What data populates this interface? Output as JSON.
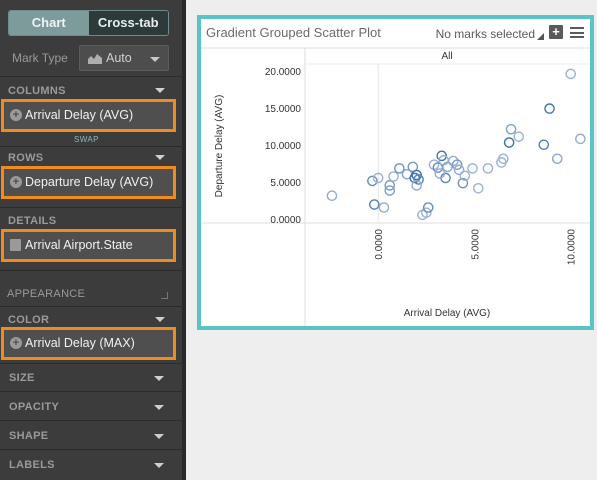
{
  "sidebar": {
    "tabs": [
      {
        "label": "Chart",
        "active": true
      },
      {
        "label": "Cross-tab",
        "active": false
      }
    ],
    "mark_type": {
      "label": "Mark Type",
      "value": "Auto",
      "icon": "area-chart-icon"
    },
    "sections": {
      "columns": {
        "label": "COLUMNS",
        "pill": "Arrival Delay (AVG)",
        "swap": "SWAP"
      },
      "rows": {
        "label": "ROWS",
        "pill": "Departure Delay (AVG)"
      },
      "details": {
        "label": "DETAILS",
        "pill": "Arrival Airport.State"
      },
      "appearance": {
        "label": "APPEARANCE"
      },
      "color": {
        "label": "COLOR",
        "pill": "Arrival Delay (MAX)"
      },
      "size": {
        "label": "SIZE"
      },
      "opacity": {
        "label": "OPACITY"
      },
      "shape": {
        "label": "SHAPE"
      },
      "labels": {
        "label": "LABELS"
      }
    },
    "colors": {
      "highlight": "#f08c1e",
      "panel": "#3c3c3c",
      "tab_active": "#7d9b9b"
    }
  },
  "chart": {
    "title": "Gradient Grouped Scatter Plot",
    "selection_status": "No marks selected",
    "border_color": "#5bc3c6"
  },
  "chart_data": {
    "type": "scatter",
    "facet_label": "All",
    "xlabel": "Arrival Delay (AVG)",
    "ylabel": "Departure Delay (AVG)",
    "x_ticks": [
      "0.0000",
      "5.0000",
      "10.0000"
    ],
    "y_ticks": [
      "0.0000",
      "5.0000",
      "10.0000",
      "15.0000",
      "20.0000"
    ],
    "xlim": [
      -3.8,
      11.0
    ],
    "ylim": [
      -0.5,
      20.5
    ],
    "color_range": [
      "#d2d4f0",
      "#1d5e9a"
    ],
    "points": [
      [
        -2.4,
        3.2,
        0.35
      ],
      [
        -0.3,
        5.2,
        0.6
      ],
      [
        -0.2,
        2.0,
        0.7
      ],
      [
        0.0,
        5.6,
        0.3
      ],
      [
        0.3,
        1.6,
        0.35
      ],
      [
        0.6,
        4.6,
        0.5
      ],
      [
        0.6,
        3.9,
        0.45
      ],
      [
        0.8,
        5.8,
        0.3
      ],
      [
        1.1,
        6.9,
        0.55
      ],
      [
        1.5,
        6.1,
        0.4
      ],
      [
        1.8,
        7.1,
        0.5
      ],
      [
        1.9,
        5.6,
        0.8
      ],
      [
        2.0,
        6.0,
        0.85
      ],
      [
        2.1,
        5.4,
        0.7
      ],
      [
        2.0,
        4.6,
        0.35
      ],
      [
        2.3,
        0.6,
        0.3
      ],
      [
        2.5,
        0.9,
        0.3
      ],
      [
        2.6,
        1.6,
        0.6
      ],
      [
        2.9,
        7.4,
        0.3
      ],
      [
        3.1,
        7.0,
        0.6
      ],
      [
        3.3,
        8.6,
        0.8
      ],
      [
        3.4,
        8.0,
        0.35
      ],
      [
        3.5,
        5.6,
        0.65
      ],
      [
        3.2,
        6.2,
        0.35
      ],
      [
        3.6,
        7.1,
        0.4
      ],
      [
        3.9,
        7.9,
        0.35
      ],
      [
        4.1,
        7.4,
        0.5
      ],
      [
        4.2,
        6.7,
        0.35
      ],
      [
        4.4,
        4.9,
        0.55
      ],
      [
        4.5,
        5.9,
        0.3
      ],
      [
        4.9,
        6.9,
        0.3
      ],
      [
        5.2,
        4.2,
        0.3
      ],
      [
        5.7,
        6.9,
        0.3
      ],
      [
        6.4,
        7.7,
        0.3
      ],
      [
        6.5,
        8.2,
        0.3
      ],
      [
        6.8,
        10.4,
        0.85
      ],
      [
        6.9,
        12.2,
        0.45
      ],
      [
        7.3,
        11.2,
        0.3
      ],
      [
        8.6,
        10.1,
        0.7
      ],
      [
        8.9,
        15.0,
        0.8
      ],
      [
        9.3,
        8.2,
        0.4
      ],
      [
        10.0,
        19.7,
        0.3
      ],
      [
        10.5,
        10.9,
        0.35
      ]
    ]
  }
}
